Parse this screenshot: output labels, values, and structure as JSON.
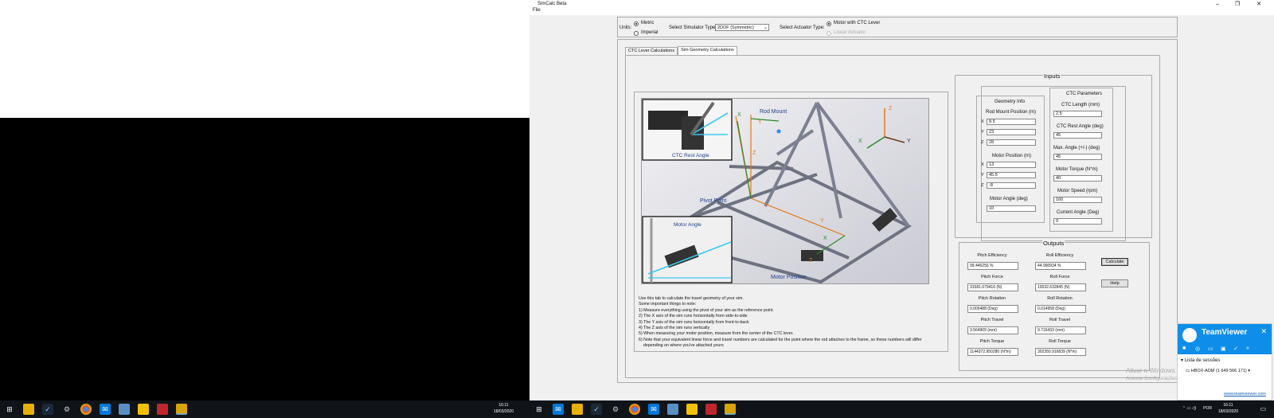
{
  "app": {
    "title": "SimCalc Beta",
    "menu": [
      "File"
    ],
    "win_min": "–",
    "win_max": "❐",
    "win_close": "✕"
  },
  "units": {
    "label": "Units:",
    "options": [
      "Metric",
      "Imperial"
    ],
    "selected": "Metric"
  },
  "simulator": {
    "label": "Select Simulator Type:",
    "value": "2DOF (Symmetric)"
  },
  "actuator": {
    "label": "Select Actuator Type:",
    "options": [
      "Motor with CTC Lever",
      "Linear Actuator"
    ],
    "selected": "Motor with CTC Lever"
  },
  "tabs": [
    {
      "label": "CTC Lever Calculations",
      "active": false
    },
    {
      "label": "Sim Geometry Calculations",
      "active": true
    }
  ],
  "diagram": {
    "labels": {
      "rod_mount": "Rod Mount",
      "ctc_rest_angle": "CTC Rest Angle",
      "pivot_point": "Pivot Point",
      "motor_angle": "Motor Angle",
      "motor_position": "Motor Position",
      "x": "X",
      "y": "Y",
      "z": "Z"
    }
  },
  "notes": [
    "Use this tab to calculate the travel geometry of your sim.",
    "Some important things to note:",
    "1) Measure everything using the pivot of your sim as the reference point.",
    "2) The X axis of the sim runs horizontally from side-to-side",
    "3) The Y axis of the sim runs horizontally from front-to-back",
    "4) The Z axis of the sim runs vertically",
    "5) When measuring your motor position, measure from the center of the CTC lever.",
    "6) Note that your equivalent linear force and travel numbers are calculated for the point where the rod attaches to the frame, so these numbers will differ",
    "    depending on where you've attached yours"
  ],
  "inputs": {
    "title": "Inputs",
    "geometry": {
      "title": "Geometry Info",
      "rod_mount_label": "Rod Mount Position (m)",
      "rod_mount": {
        "x": "8.5",
        "y": "23",
        "z": "28"
      },
      "motor_pos_label": "Motor Position (m)",
      "motor_pos": {
        "x": "13",
        "y": "45.5",
        "z": "-8"
      },
      "motor_angle_label": "Motor Angle (deg)",
      "motor_angle": "10",
      "axes": {
        "x": "X",
        "y": "Y",
        "z": "Z"
      }
    },
    "ctc": {
      "title": "CTC Parameters",
      "length_label": "CTC Length (mm)",
      "length": "2.5",
      "rest_angle_label": "CTC Rest Angle (deg)",
      "rest_angle": "45",
      "max_angle_label": "Max. Angle (+/-) (deg)",
      "max_angle": "45",
      "torque_label": "Motor Torque (N*m)",
      "torque": "40",
      "speed_label": "Motor Speed (rpm)",
      "speed": "160",
      "current_angle_label": "Current Angle (Deg)",
      "current_angle": "0"
    }
  },
  "outputs": {
    "title": "Outputs",
    "pitch_eff_label": "Pitch Efficiency",
    "pitch_eff": "99.445256   %",
    "roll_eff_label": "Roll Efficiency",
    "roll_eff": "44.990934   %",
    "pitch_force_label": "Pitch Force",
    "pitch_force": "31581.679416   (N)",
    "roll_force_label": "Roll Force",
    "roll_force": "10032.632845   (N)",
    "pitch_rot_label": "Pitch Rotation",
    "pitch_rot": "0.005488   (Deg)",
    "roll_rot_label": "Roll Rotation",
    "roll_rot": "0.014958   (Deg)",
    "pitch_travel_label": "Pitch Travel",
    "pitch_travel": "3.564909   (mm)",
    "roll_travel_label": "Roll Travel",
    "roll_travel": "9.716433   (mm)",
    "pitch_torque_label": "Pitch Torque",
    "pitch_torque": "1144372.950280   (N*m)",
    "roll_torque_label": "Roll Torque",
    "roll_torque": "302350.916839   (N*m)",
    "calculate_label": "Calculate",
    "help_label": "Help"
  },
  "watermark": [
    "Ativar o Windows",
    "Acesse Configurações"
  ],
  "teamviewer": {
    "title": "TeamViewer",
    "session_list": "Lista de sessões",
    "session_item": "HBOX-ADM (1 649 566 171)",
    "link": "www.teamviewer.com"
  },
  "taskbar": {
    "time": "16:11",
    "date": "18/03/2020",
    "lang": "POR"
  }
}
